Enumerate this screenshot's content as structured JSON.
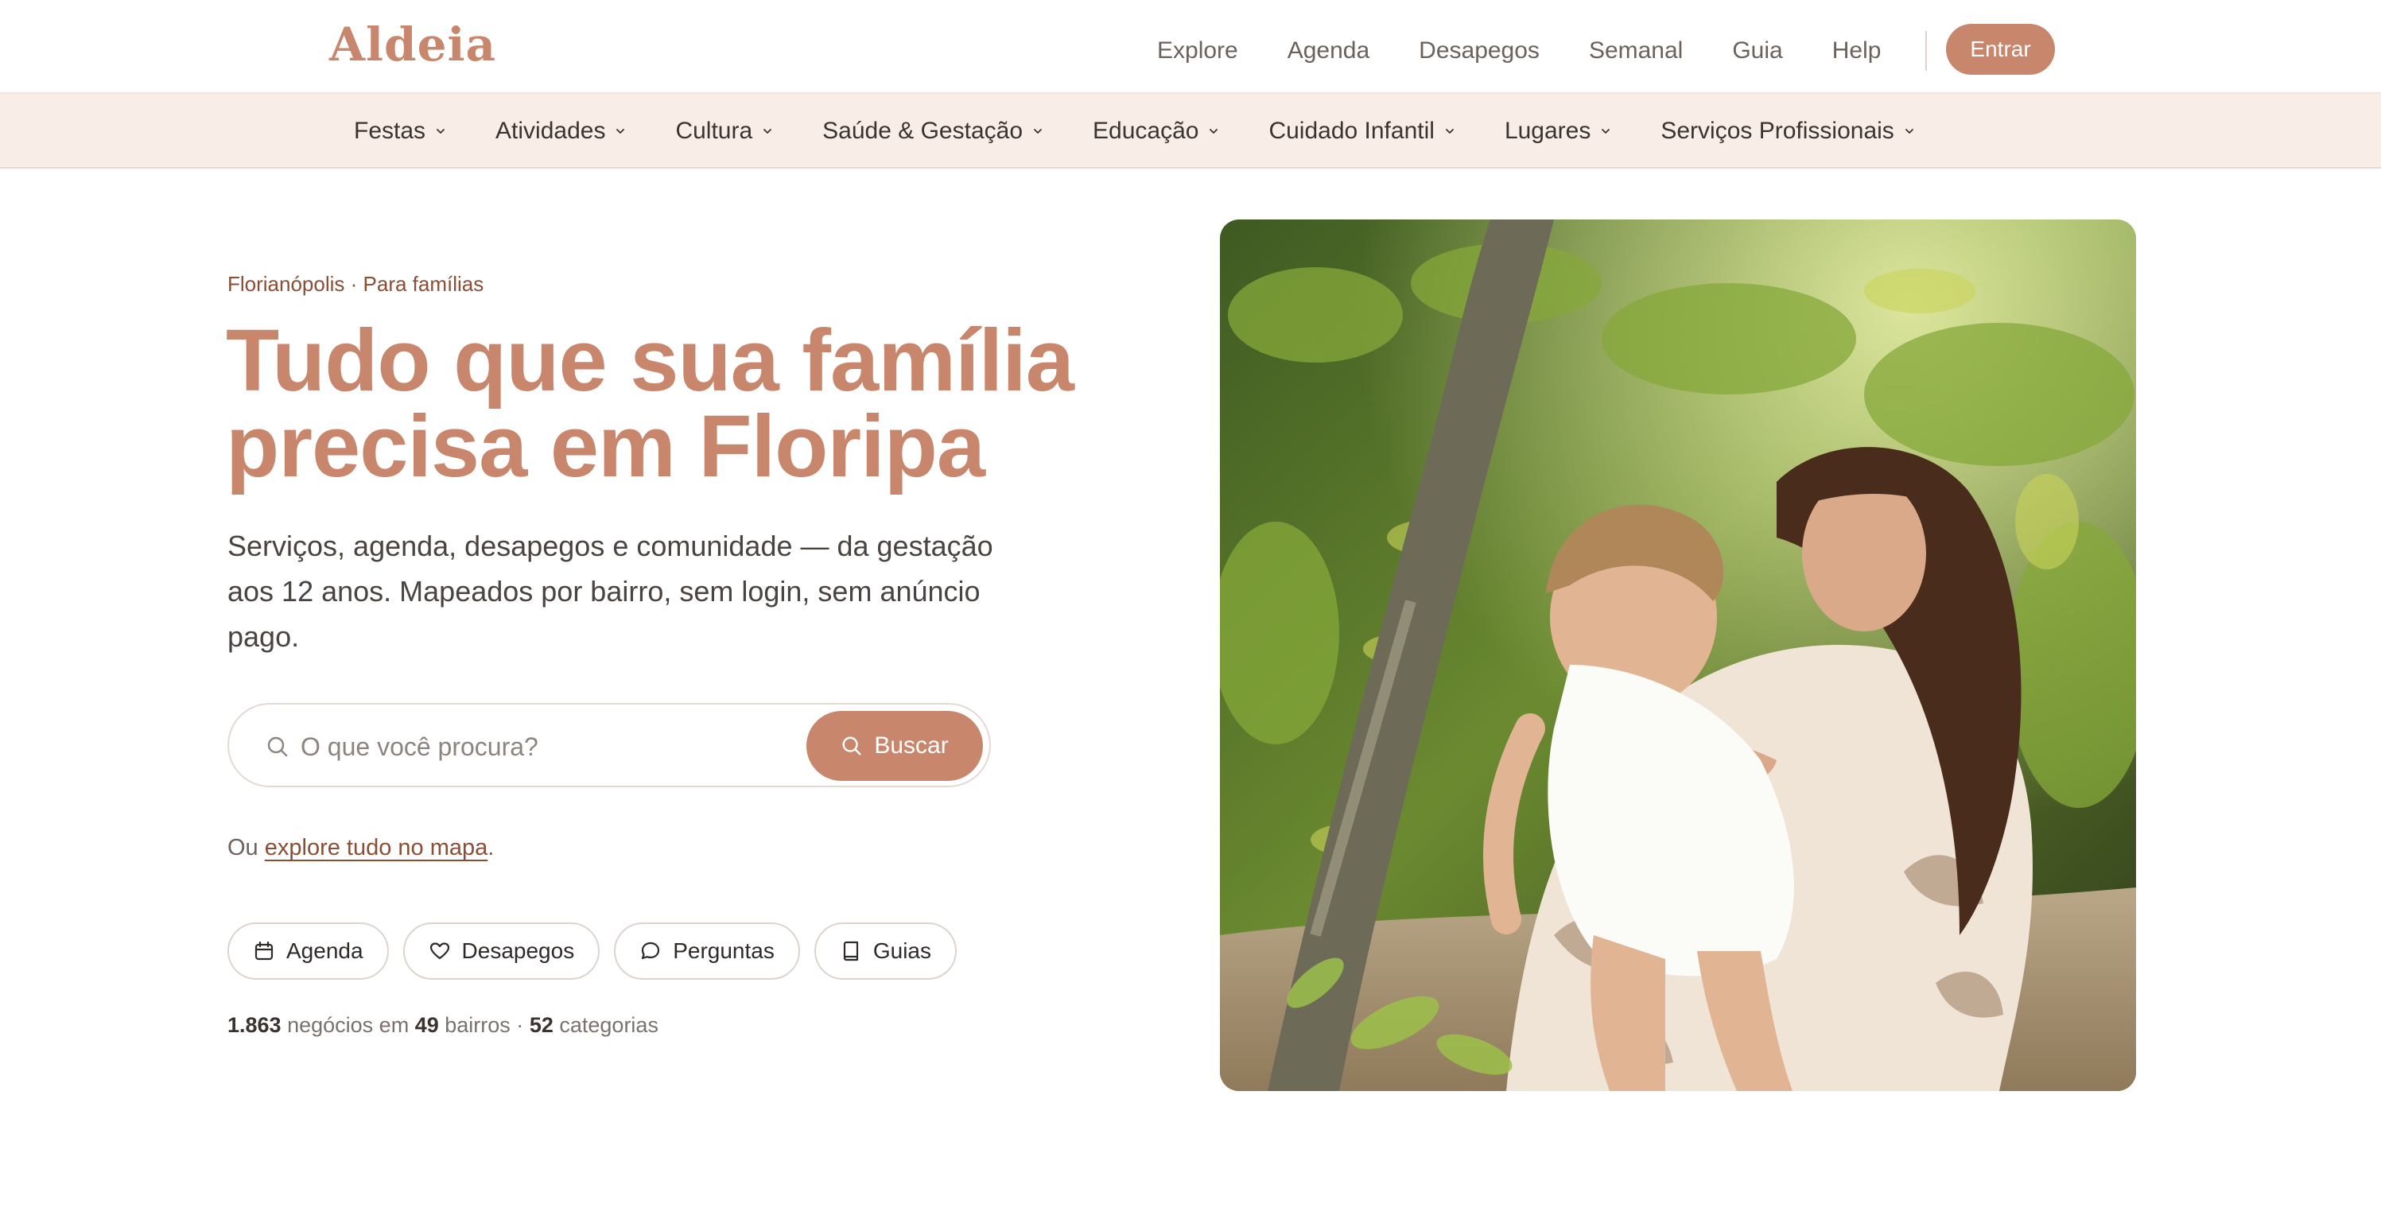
{
  "brand": {
    "logo": "Aldeia",
    "accent": "#c8876d",
    "accent_dark": "#8a4e35"
  },
  "topnav": {
    "links": [
      "Explore",
      "Agenda",
      "Desapegos",
      "Semanal",
      "Guia",
      "Help"
    ],
    "login_label": "Entrar"
  },
  "categories": [
    "Festas",
    "Atividades",
    "Cultura",
    "Saúde & Gestação",
    "Educação",
    "Cuidado Infantil",
    "Lugares",
    "Serviços Profissionais"
  ],
  "hero": {
    "kicker": "Florianópolis · Para famílias",
    "headline_line1": "Tudo que sua família",
    "headline_line2": "precisa em Floripa",
    "subtitle": "Serviços, agenda, desapegos e comunidade — da gestação aos 12 anos. Mapeados por bairro, sem login, sem anúncio pago."
  },
  "search": {
    "placeholder": "O que você procura?",
    "value": "",
    "button_label": "Buscar",
    "icon": "search-icon"
  },
  "map_prompt": {
    "prefix": "Ou",
    "link_label": "explore tudo no mapa",
    "suffix": "."
  },
  "shortcuts": [
    {
      "label": "Agenda",
      "icon": "calendar-icon"
    },
    {
      "label": "Desapegos",
      "icon": "heart-icon"
    },
    {
      "label": "Perguntas",
      "icon": "chat-bubble-icon"
    },
    {
      "label": "Guias",
      "icon": "book-icon"
    }
  ],
  "stats": {
    "businesses_count": "1.863",
    "businesses_label": "negócios em",
    "neighborhoods_count": "49",
    "neighborhoods_label": "bairros ·",
    "categories_count": "52",
    "categories_label": "categorias"
  }
}
